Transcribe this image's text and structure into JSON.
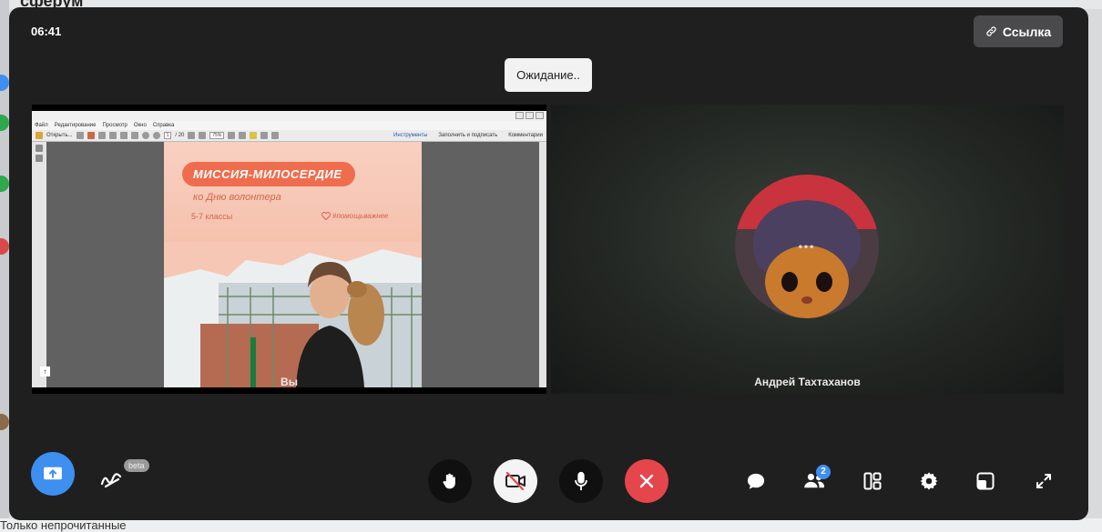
{
  "background": {
    "brand": "сферум",
    "filter_label": "Только непрочитанные"
  },
  "call": {
    "timer": "06:41",
    "link_button": "Ссылка",
    "status_toast": "Ожидание.."
  },
  "tiles": {
    "self_label": "Вы",
    "remote_label": "Андрей Тахтаханов",
    "remote_dots": "•••"
  },
  "shared_screen": {
    "menu": [
      "Файл",
      "Редактирование",
      "Просмотр",
      "Окно",
      "Справка"
    ],
    "open_label": "Открыть...",
    "page_field": "1",
    "page_total": "/ 20",
    "zoom_field": "75%",
    "tools_right": [
      "Инструменты",
      "Заполнить и подписать",
      "Комментарии"
    ],
    "slide_title": "МИССИЯ-МИЛОСЕРДИЕ",
    "slide_subtitle": "ко Дню волонтера",
    "slide_grade": "5-7 классы",
    "slide_brand": "#помощьважнее"
  },
  "controls": {
    "beta_label": "beta",
    "participants_count": "2"
  },
  "colors": {
    "call_bg": "#1f1f20",
    "share_button": "#3d8ff0",
    "hangup_button": "#e5464b",
    "slide_accent": "#ef6d4d"
  },
  "icons": {
    "link": "link-icon",
    "share": "screen-share-icon",
    "whiteboard": "whiteboard-icon",
    "hand": "raise-hand-icon",
    "camera": "camera-off-icon",
    "mic": "microphone-icon",
    "hangup": "close-icon",
    "chat": "chat-icon",
    "people": "participants-icon",
    "layout": "layout-icon",
    "settings": "gear-icon",
    "pip": "picture-in-picture-icon",
    "fullscreen": "fullscreen-icon"
  }
}
